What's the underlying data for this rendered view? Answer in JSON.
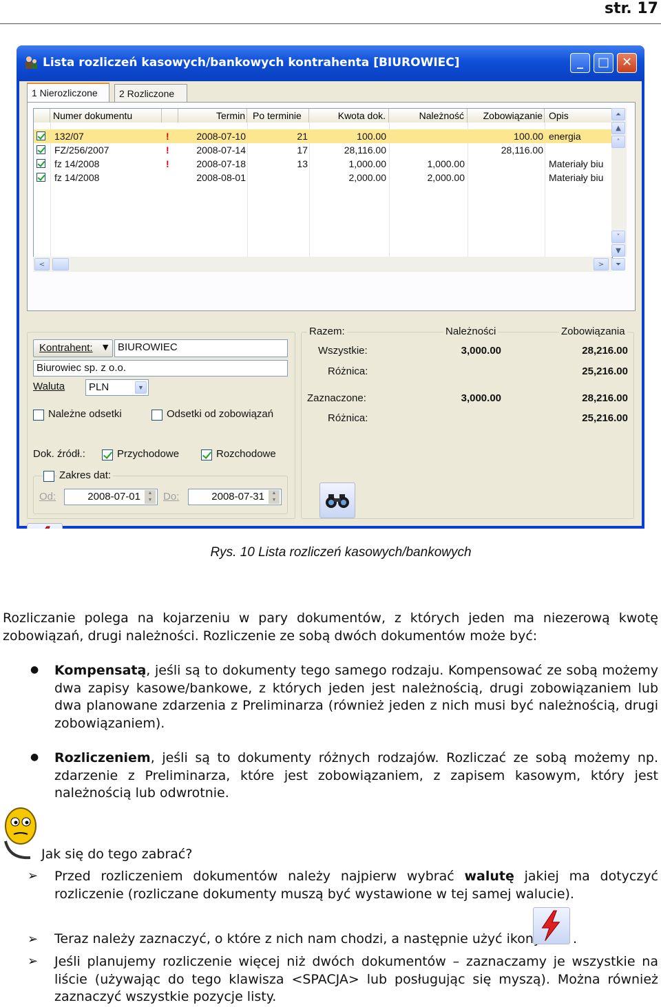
{
  "page_number": "str. 17",
  "window": {
    "title": "Lista rozliczeń kasowych/bankowych kontrahenta [BIUROWIEC]",
    "tabs": [
      "1 Nierozliczone",
      "2 Rozliczone"
    ],
    "columns": {
      "numer": "Numer dokumentu",
      "termin": "Termin",
      "po_terminie": "Po terminie",
      "kwota": "Kwota dok.",
      "naleznosc": "Należność",
      "zobowiazanie": "Zobowiązanie",
      "opis": "Opis"
    },
    "rows": [
      {
        "numer": "132/07",
        "flag": "!",
        "termin": "2008-07-10",
        "po_terminie": "21",
        "kwota": "100.00",
        "naleznosc": "",
        "zobowiazanie": "100.00",
        "opis": "energia"
      },
      {
        "numer": "FZ/256/2007",
        "flag": "!",
        "termin": "2008-07-14",
        "po_terminie": "17",
        "kwota": "28,116.00",
        "naleznosc": "",
        "zobowiazanie": "28,116.00",
        "opis": ""
      },
      {
        "numer": "fz 14/2008",
        "flag": "!",
        "termin": "2008-07-18",
        "po_terminie": "13",
        "kwota": "1,000.00",
        "naleznosc": "1,000.00",
        "zobowiazanie": "",
        "opis": "Materiały biu"
      },
      {
        "numer": "fz 14/2008",
        "flag": "",
        "termin": "2008-08-01",
        "po_terminie": "",
        "kwota": "2,000.00",
        "naleznosc": "2,000.00",
        "zobowiazanie": "",
        "opis": "Materiały biu"
      }
    ],
    "filter": {
      "kontrahent_label": "Kontrahent:",
      "kontrahent_value": "BIUROWIEC",
      "kontrahent_name": "Biurowiec sp. z o.o.",
      "waluta_label": "Waluta",
      "waluta_value": "PLN",
      "nalezne_odsetki": "Należne odsetki",
      "odsetki_zobowiazan": "Odsetki od zobowiązań",
      "dok_zrodl_label": "Dok. źródł.:",
      "przychodowe": "Przychodowe",
      "rozchodowe": "Rozchodowe",
      "zakres_dat": "Zakres dat:",
      "od_label": "Od:",
      "od_value": "2008-07-01",
      "do_label": "Do:",
      "do_value": "2008-07-31"
    },
    "summary": {
      "razem": "Razem:",
      "naleznosci": "Należności",
      "zobowiazania": "Zobowiązania",
      "wszystkie": "Wszystkie:",
      "roznica": "Różnica:",
      "zaznaczone": "Zaznaczone:",
      "wszystkie_nal": "3,000.00",
      "wszystkie_zob": "28,216.00",
      "roznica1_zob": "25,216.00",
      "zaznaczone_nal": "3,000.00",
      "zaznaczone_zob": "28,216.00",
      "roznica2_zob": "25,216.00"
    }
  },
  "caption": "Rys. 10 Lista rozliczeń kasowych/bankowych",
  "intro": "Rozliczanie polega na kojarzeniu w pary dokumentów, z których jeden ma niezerową kwotę zobowiązań, drugi należności. Rozliczenie ze sobą dwóch dokumentów może być:",
  "bullets": [
    {
      "bold": "Kompensatą",
      "text": ", jeśli są to dokumenty tego samego rodzaju. Kompensować ze sobą możemy dwa zapisy kasowe/bankowe, z których jeden jest należnością, drugi zobowiązaniem lub dwa planowane zdarzenia z Preliminarza (również jeden z nich musi być należnością, drugi zobowiązaniem)."
    },
    {
      "bold": "Rozliczeniem",
      "text": ", jeśli są to dokumenty różnych rodzajów. Rozliczać ze sobą możemy np. zdarzenie z Preliminarza, które jest zobowiązaniem, z zapisem kasowym, który jest należnością lub odwrotnie."
    }
  ],
  "howto": "Jak się do tego zabrać?",
  "steps": {
    "s1a": "Przed rozliczeniem dokumentów należy najpierw wybrać ",
    "s1b": "walutę",
    "s1c": " jakiej ma dotyczyć rozliczenie (rozliczane dokumenty muszą być wystawione w tej samej walucie).",
    "s2": "Teraz należy zaznaczyć, o które z nich nam chodzi, a następnie użyć ikony",
    "s2end": ".",
    "s3": "Jeśli planujemy rozliczenie więcej niż dwóch dokumentów – zaznaczamy je wszystkie na liście (używając do tego klawisza <SPACJA> lub posługując się myszą). Można również zaznaczyć wszystkie pozycje listy."
  }
}
